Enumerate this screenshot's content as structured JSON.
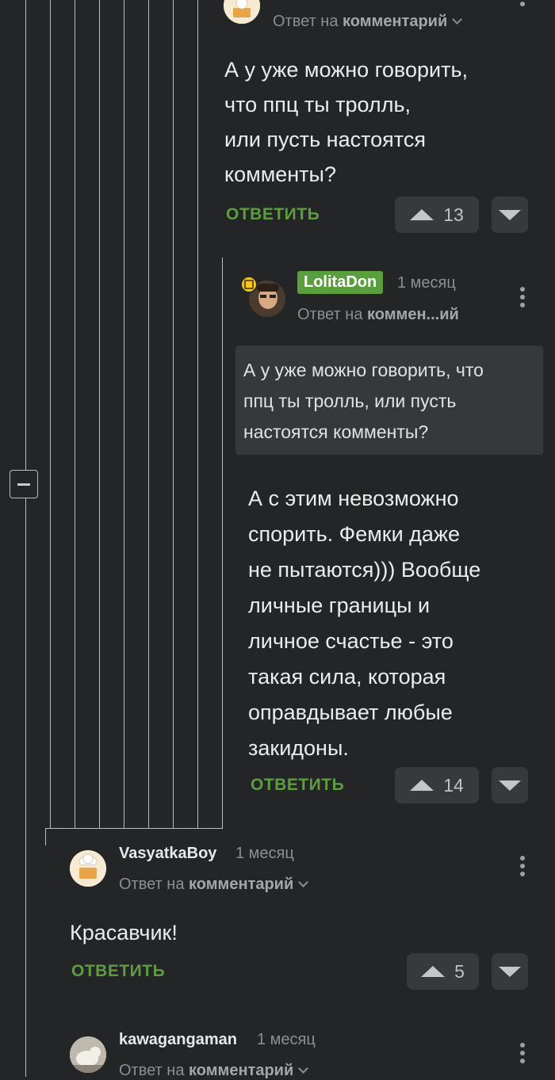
{
  "comments": [
    {
      "reply_prefix": "Ответ на",
      "reply_target": "комментарий",
      "text_lines": [
        "А у уже можно говорить,",
        "что ппц ты тролль,",
        "или пусть настоятся",
        "комменты?"
      ],
      "reply_label": "ОТВЕТИТЬ",
      "votes": "13"
    },
    {
      "username": "LolitaDon",
      "time": "1 месяц",
      "reply_prefix": "Ответ на",
      "reply_target": "коммен...ий",
      "quote_lines": [
        "А у уже можно говорить, что",
        "ппц ты тролль, или пусть",
        "настоятся комменты?"
      ],
      "text_lines": [
        "А с этим невозможно",
        "спорить. Фемки даже",
        "не пытаются))) Вообще",
        "личные границы и",
        "личное счастье - это",
        "такая сила, которая",
        "оправдывает любые",
        "закидоны."
      ],
      "reply_label": "ОТВЕТИТЬ",
      "votes": "14"
    },
    {
      "username": "VasyatkaBoy",
      "time": "1 месяц",
      "reply_prefix": "Ответ на",
      "reply_target": "комментарий",
      "text": "Красавчик!",
      "reply_label": "ОТВЕТИТЬ",
      "votes": "5"
    },
    {
      "username": "kawagangaman",
      "time": "1 месяц",
      "reply_prefix": "Ответ на",
      "reply_target": "комментарий"
    }
  ],
  "colors": {
    "background": "#232527",
    "accent_green": "#5e9d3f",
    "badge_green": "#5b9e3e"
  },
  "icons": [
    "collapse-minus-icon",
    "more-vertical-icon",
    "arrow-up-icon",
    "arrow-down-icon",
    "chevron-down-icon",
    "badge-icon"
  ]
}
